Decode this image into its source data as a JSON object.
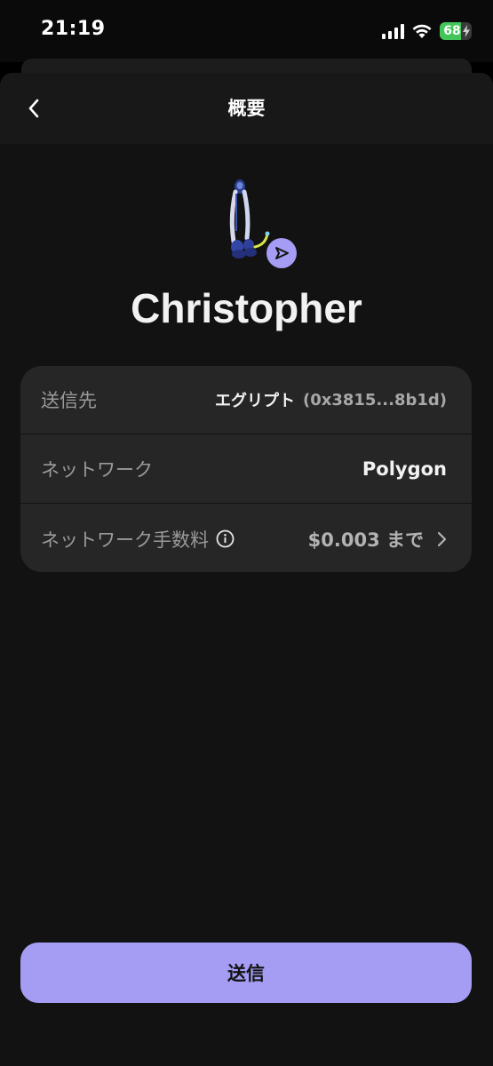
{
  "status_bar": {
    "time": "21:19",
    "battery_percent": "68",
    "icons": [
      "signal-icon",
      "wifi-icon",
      "battery-icon"
    ]
  },
  "header": {
    "title": "概要",
    "back_icon": "chevron-left-icon"
  },
  "recipient": {
    "name": "Christopher",
    "avatar": "nft-avatar",
    "badge_icon": "send-icon"
  },
  "details": {
    "recipient_row": {
      "label": "送信先",
      "value_name": "エグリプト",
      "value_address": "(0x3815...8b1d)"
    },
    "network_row": {
      "label": "ネットワーク",
      "value": "Polygon"
    },
    "fee_row": {
      "label": "ネットワーク手数料",
      "info_icon": "info-icon",
      "value": "$0.003 まで",
      "chevron_icon": "chevron-right-icon"
    }
  },
  "actions": {
    "send_label": "送信"
  },
  "colors": {
    "accent": "#a59df3",
    "background": "#121212",
    "card": "#262626",
    "battery_green": "#43c659"
  }
}
